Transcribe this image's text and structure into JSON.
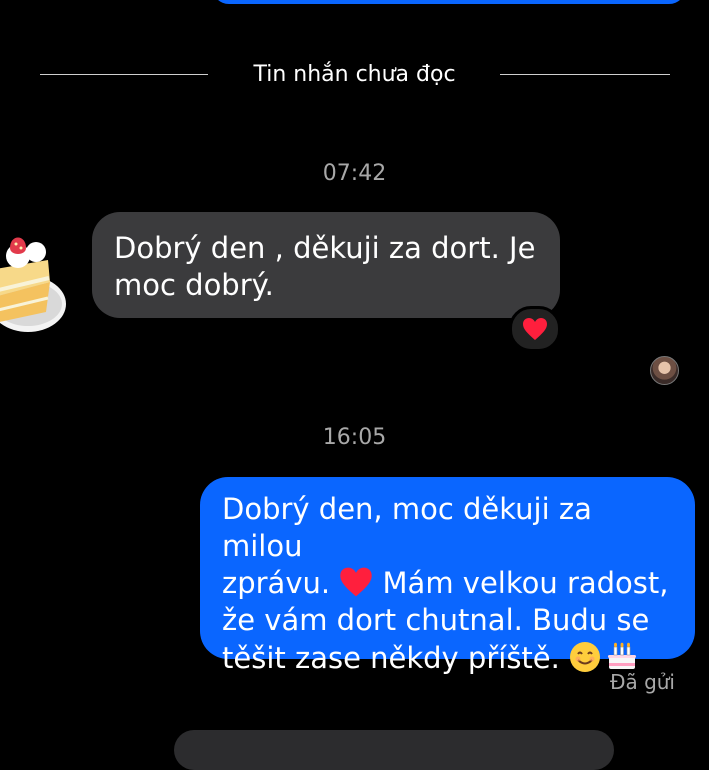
{
  "divider": {
    "label": "Tin nhắn chưa đọc"
  },
  "messages": [
    {
      "time": "07:42",
      "text": "Dobrý den , děkuji za dort. Je moc dobrý.",
      "reaction_icon": "heart-icon"
    },
    {
      "time": "16:05",
      "lines": [
        "Dobrý den, moc děkuji za milou",
        "zprávu. ",
        " Mám velkou radost,",
        "že vám dort chutnal. Budu se",
        "těšit zase někdy příště. "
      ],
      "status": "Đã gửi"
    }
  ],
  "colors": {
    "outgoing": "#0a66ff",
    "incoming": "#3b3b3d",
    "background": "#000000"
  }
}
